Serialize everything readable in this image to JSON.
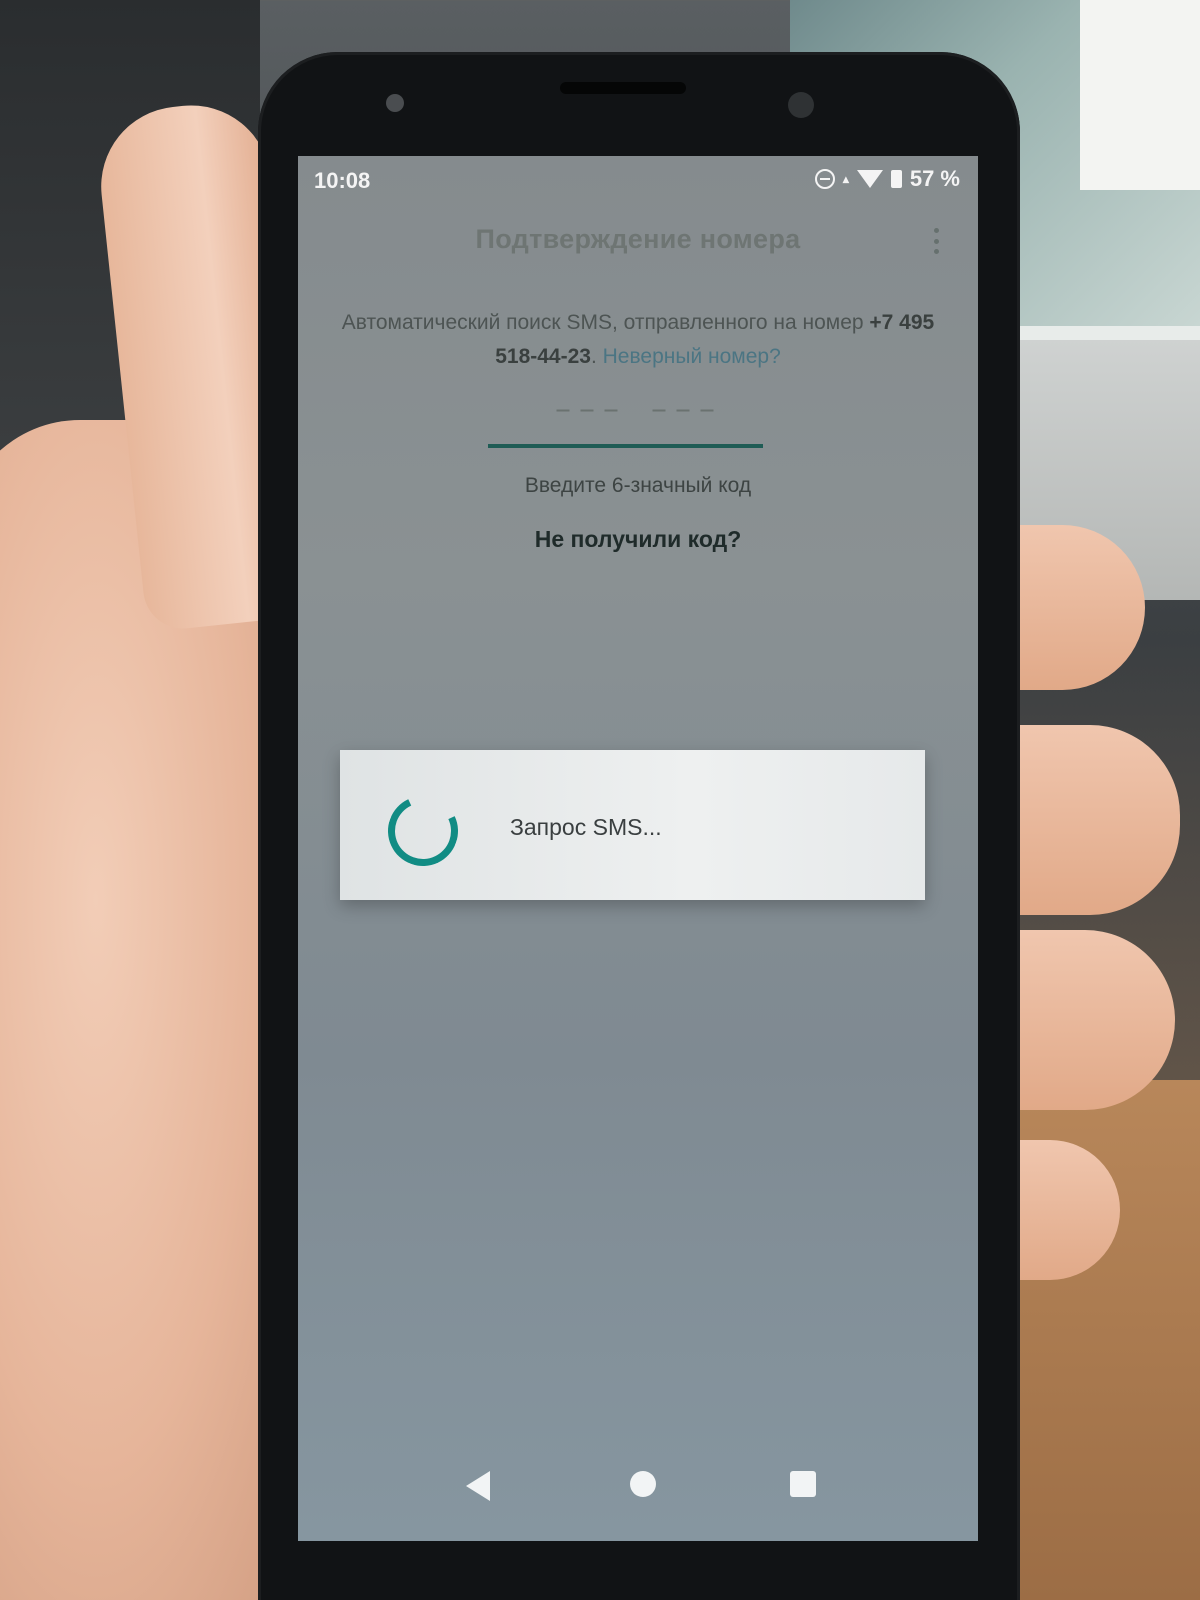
{
  "status_bar": {
    "time": "10:08",
    "battery": "57 %"
  },
  "app_bar": {
    "title": "Подтверждение номера"
  },
  "verification": {
    "description_prefix": "Автоматический поиск SMS, отправленного на номер ",
    "phone_number": "+7 495 518-44-23",
    "description_suffix": ". ",
    "wrong_number_link": "Неверный номер?",
    "code_placeholder": "––– –––",
    "hint": "Введите 6-значный код",
    "resend_link": "Не получили код?"
  },
  "dialog": {
    "message": "Запрос SMS..."
  },
  "colors": {
    "accent": "#118c84",
    "link": "#4b7583"
  }
}
